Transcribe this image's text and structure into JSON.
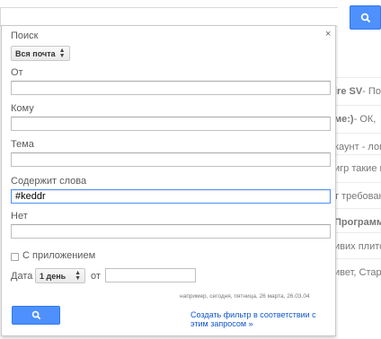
{
  "background": {
    "rows": [
      {
        "sender": "ire SV",
        "snippet": " - По"
      },
      {
        "sender": "ме:)",
        "snippet": " - ОК, "
      },
      {
        "sender": "",
        "snippet": "каунт - лог"
      },
      {
        "sender": "",
        "snippet": "игр такие г"
      },
      {
        "sender": "",
        "snippet": "т требовани"
      },
      {
        "sender": "",
        "snippet": "Программа"
      },
      {
        "sender": "",
        "snippet": "ивих плито"
      },
      {
        "sender": "",
        "snippet": "ивет, Старт"
      }
    ]
  },
  "panel": {
    "title": "Поиск",
    "close": "×",
    "scope_select": "Вся почта",
    "from_label": "От",
    "from_value": "",
    "to_label": "Кому",
    "to_value": "",
    "subject_label": "Тема",
    "subject_value": "",
    "has_words_label": "Содержит слова",
    "has_words_value": "#keddr",
    "doesnt_have_label": "Нет",
    "doesnt_have_value": "",
    "attachment_label": "С приложением",
    "date_label": "Дата",
    "date_range_select": "1 день",
    "date_from_label": "от",
    "date_value": "",
    "date_hint": "например, сегодня, пятница, 26 марта, 26.03.04",
    "create_filter_line1": "Создать фильтр в соответствии с",
    "create_filter_line2": "этим запросом »"
  },
  "colors": {
    "accent": "#4d90fe",
    "link": "#1155cc"
  }
}
